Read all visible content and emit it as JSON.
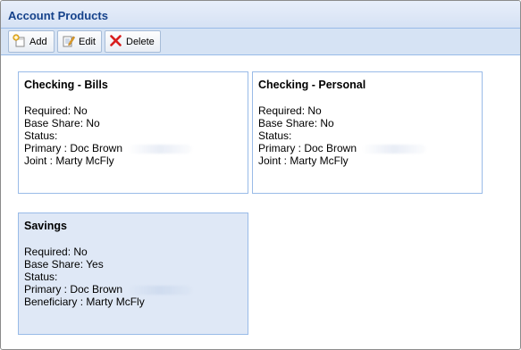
{
  "panel": {
    "title": "Account Products"
  },
  "toolbar": {
    "add_label": "Add",
    "edit_label": "Edit",
    "delete_label": "Delete"
  },
  "cards": [
    {
      "title": "Checking - Bills",
      "lines": [
        "Required: No",
        "Base Share: No",
        "Status:",
        "Primary : Doc Brown",
        "Joint : Marty McFly"
      ],
      "selected": false
    },
    {
      "title": "Checking - Personal",
      "lines": [
        "Required: No",
        "Base Share: No",
        "Status:",
        "Primary : Doc Brown",
        "Joint : Marty McFly"
      ],
      "selected": false
    },
    {
      "title": "Savings",
      "lines": [
        "Required: No",
        "Base Share: Yes",
        "Status:",
        "Primary : Doc Brown",
        "Beneficiary : Marty McFly"
      ],
      "selected": true
    }
  ],
  "colors": {
    "header_text": "#15428b",
    "border": "#99bbe8",
    "selected_bg": "#dfe8f6",
    "delete_icon": "#d81e1e"
  },
  "icons": [
    "add-icon",
    "edit-icon",
    "delete-icon"
  ]
}
